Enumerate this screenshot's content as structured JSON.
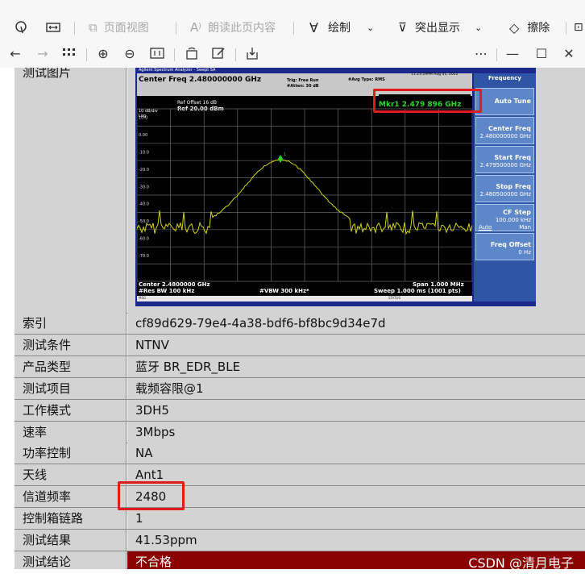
{
  "toolbar": {
    "page_view": "页面视图",
    "read_aloud": "朗读此页内容",
    "draw": "绘制",
    "highlight": "突出显示",
    "erase": "擦除"
  },
  "doc": {
    "image_label": "测试图片",
    "rows": [
      {
        "label": "索引",
        "value": "cf89d629-79e4-4a38-bdf6-bf8bc9d34e7d"
      },
      {
        "label": "测试条件",
        "value": "NTNV"
      },
      {
        "label": "产品类型",
        "value": "蓝牙 BR_EDR_BLE"
      },
      {
        "label": "测试项目",
        "value": "载频容限@1"
      },
      {
        "label": "工作模式",
        "value": "3DH5"
      },
      {
        "label": "速率",
        "value": "3Mbps"
      },
      {
        "label": "功率控制",
        "value": "NA"
      },
      {
        "label": "天线",
        "value": "Ant1"
      },
      {
        "label": "信道频率",
        "value": "2480"
      },
      {
        "label": "控制箱链路",
        "value": "1"
      },
      {
        "label": "测试结果",
        "value": "41.53ppm"
      },
      {
        "label": "测试结论",
        "value": "不合格"
      }
    ]
  },
  "analyzer": {
    "window_title": "Agilent Spectrum Analyzer - Swept SA",
    "center_freq": "Center Freq 2.480000000 GHz",
    "marker": "Mkr1 2.479 896 GHz",
    "ref_offset": "Ref Offset 16 dB",
    "ref": "Ref 20.00 dBm",
    "scale": "10 dB/div",
    "log": "Log",
    "trig": "Trig: Free Run",
    "atten": "#Atten: 30 dB",
    "avg_type": "#Avg Type: RMS",
    "datetime": "11:23:29PM Aug 01, 2022",
    "center_bottom": "Center 2.4800000 GHz",
    "res_bw": "#Res BW 100 kHz",
    "vbw": "#VBW 300 kHz*",
    "span": "Span 1.000 MHz",
    "sweep": "Sweep 1.000 ms (1001 pts)",
    "y_ticks": [
      "10.0",
      "0.00",
      "-10.0",
      "-20.0",
      "-30.0",
      "-40.0",
      "-50.0",
      "-60.0",
      "-70.0"
    ],
    "softkeys": {
      "header": "Frequency",
      "items": [
        {
          "title": "Auto Tune",
          "sub": ""
        },
        {
          "title": "Center Freq",
          "sub": "2.480000000 GHz"
        },
        {
          "title": "Start Freq",
          "sub": "2.479500000 GHz"
        },
        {
          "title": "Stop Freq",
          "sub": "2.480500000 GHz"
        },
        {
          "title": "CF Step",
          "sub": "100.000 kHz"
        },
        {
          "title": "Freq Offset",
          "sub": "0 Hz"
        }
      ],
      "cf_auto": "Auto",
      "cf_man": "Man"
    },
    "status": "STATUS",
    "msg": "MSG"
  },
  "watermark": "CSDN @清月电子",
  "colors": {
    "fail_bg": "#8b0000",
    "cell_bg": "#d3d3d3",
    "highlight_box": "#e01b1b",
    "trace": "#d4d400"
  }
}
